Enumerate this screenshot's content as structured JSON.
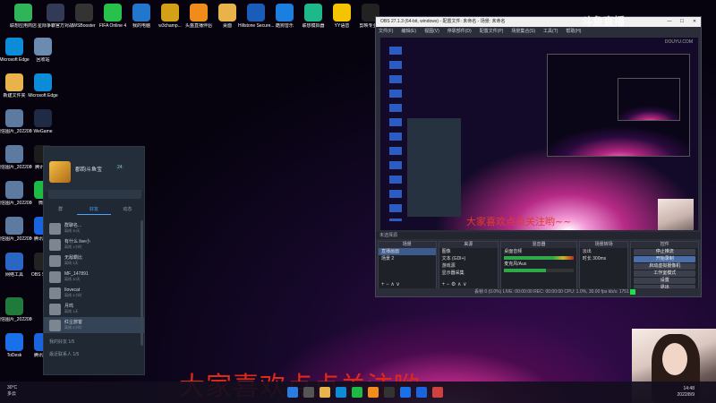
{
  "desktop": {
    "icons": [
      {
        "label": "联想应用商店",
        "icon": "store-icon",
        "color": "#2fb45a"
      },
      {
        "label": "星际争霸官方对战平台",
        "icon": "game-icon",
        "color": "#333a55"
      },
      {
        "label": "WSBooster",
        "icon": "rocket-icon",
        "color": "#333"
      },
      {
        "label": "FIFA Online 4",
        "icon": "fifa-icon",
        "color": "#27c24c"
      },
      {
        "label": "我的电脑",
        "icon": "computer-icon",
        "color": "#2277cc"
      },
      {
        "label": "w3champ...",
        "icon": "folder-icon",
        "color": "#d4a017"
      },
      {
        "label": "头盔直播伴侣",
        "icon": "live-icon",
        "color": "#f08c1a"
      },
      {
        "label": "桌面",
        "icon": "folder-icon",
        "color": "#e8b34a"
      },
      {
        "label": "Hillstone Secure...",
        "icon": "secure-icon",
        "color": "#1a5db8"
      },
      {
        "label": "酷狗音乐",
        "icon": "kugou-icon",
        "color": "#1a7fe0"
      },
      {
        "label": "联想模拟器",
        "icon": "emulator-icon",
        "color": "#1fb88a"
      },
      {
        "label": "YY语音",
        "icon": "yy-icon",
        "color": "#f5c400"
      },
      {
        "label": "剪映专业版",
        "icon": "capcut-icon",
        "color": "#222"
      },
      {
        "label": "Microsoft Edge",
        "icon": "edge-icon",
        "color": "#0c8bd6"
      },
      {
        "label": "回收站",
        "icon": "recycle-bin-icon",
        "color": "#6c8bb0"
      },
      {
        "label": "新建文件夹",
        "icon": "folder-icon",
        "color": "#e8b34a"
      },
      {
        "label": "Microsoft Edge",
        "icon": "edge-icon",
        "color": "#0c8bd6"
      },
      {
        "label": "微信图片_2022080...",
        "icon": "image-icon",
        "color": "#5d7aa0"
      },
      {
        "label": "WeGame",
        "icon": "wegame-icon",
        "color": "#1f2a44"
      },
      {
        "label": "微信图片_2022080...",
        "icon": "image-icon",
        "color": "#5d7aa0"
      },
      {
        "label": "腾讯QQ",
        "icon": "qq-icon",
        "color": "#1c1c1c"
      },
      {
        "label": "微信图片_2022080...",
        "icon": "image-icon",
        "color": "#5d7aa0"
      },
      {
        "label": "微信",
        "icon": "wechat-icon",
        "color": "#1dba45"
      },
      {
        "label": "微信图片_2022080...",
        "icon": "image-icon",
        "color": "#5d7aa0"
      },
      {
        "label": "腾讯会议",
        "icon": "meeting-icon",
        "color": "#1a64e0"
      },
      {
        "label": "网络工具",
        "icon": "network-icon",
        "color": "#2a67c4"
      },
      {
        "label": "OBS Studio",
        "icon": "obs-icon",
        "color": "#222"
      },
      {
        "label": "微信图片_2022080...",
        "icon": "excel-icon",
        "color": "#1f7a3c"
      },
      {
        "label": "ToDesk",
        "icon": "todesk-icon",
        "color": "#1a70e8"
      },
      {
        "label": "腾讯会议",
        "icon": "meeting-icon",
        "color": "#1a64e0"
      }
    ]
  },
  "chat": {
    "username": "郡韵斗鱼宝",
    "level": "24",
    "search_placeholder": "",
    "tabs": [
      "群",
      "好友",
      "动态"
    ],
    "contacts": [
      {
        "name": "群聊名...",
        "status": "离线 30天"
      },
      {
        "name": "有什么 live小",
        "status": "离线 1小时"
      },
      {
        "name": "无敌霸比",
        "status": "离线 3天"
      },
      {
        "name": "MF_147891",
        "status": "离线 30天"
      },
      {
        "name": "Ilovecat",
        "status": "离线 2小时"
      },
      {
        "name": "月鸣",
        "status": "离线 1天"
      },
      {
        "name": "红尘旅客",
        "status": "离线 2小时"
      }
    ],
    "groups": [
      "我的好友 1/5",
      "最近联系人 1/5"
    ]
  },
  "obs": {
    "title": "OBS 27.1.3 (64-bit, windows) - 配置文件: 未命名 - 场景: 未命名",
    "menu": [
      "文件(F)",
      "编辑(E)",
      "视图(V)",
      "停靠部件(D)",
      "配置文件(P)",
      "场景集合(S)",
      "工具(T)",
      "帮助(H)"
    ],
    "preview_logo": "DOUYU.COM",
    "preview_text": "大家喜欢点点关注哟~~",
    "source_bar": "未选择源",
    "docks": {
      "scenes": {
        "title": "场景",
        "items": [
          "直播画面",
          "场景 2"
        ]
      },
      "sources": {
        "title": "来源",
        "items": [
          "图像",
          "文本 (GDI+)",
          "游戏源",
          "显示器采集"
        ]
      },
      "mixer": {
        "title": "混音器",
        "items": [
          "桌面音频",
          "麦克风/Aux"
        ]
      },
      "transitions": {
        "title": "场景转场",
        "items": [
          "淡出",
          "时长 300ms"
        ]
      },
      "controls": {
        "title": "控件",
        "items": [
          "停止推流",
          "开始录制",
          "启动虚拟摄像机",
          "工作室模式",
          "设置",
          "退出"
        ]
      }
    },
    "status": "丢帧 0 (0.0%)   LIVE: 00:00:00   REC: 00:00:00   CPU: 1.0%, 30.00 fps   kb/s: 1751"
  },
  "banner": "大家喜欢点点关注哟~~",
  "watermark": "斗鱼直播",
  "taskbar": {
    "weather_temp": "30°C",
    "weather_text": "多云",
    "time": "14:48",
    "date": "2022/8/9"
  }
}
